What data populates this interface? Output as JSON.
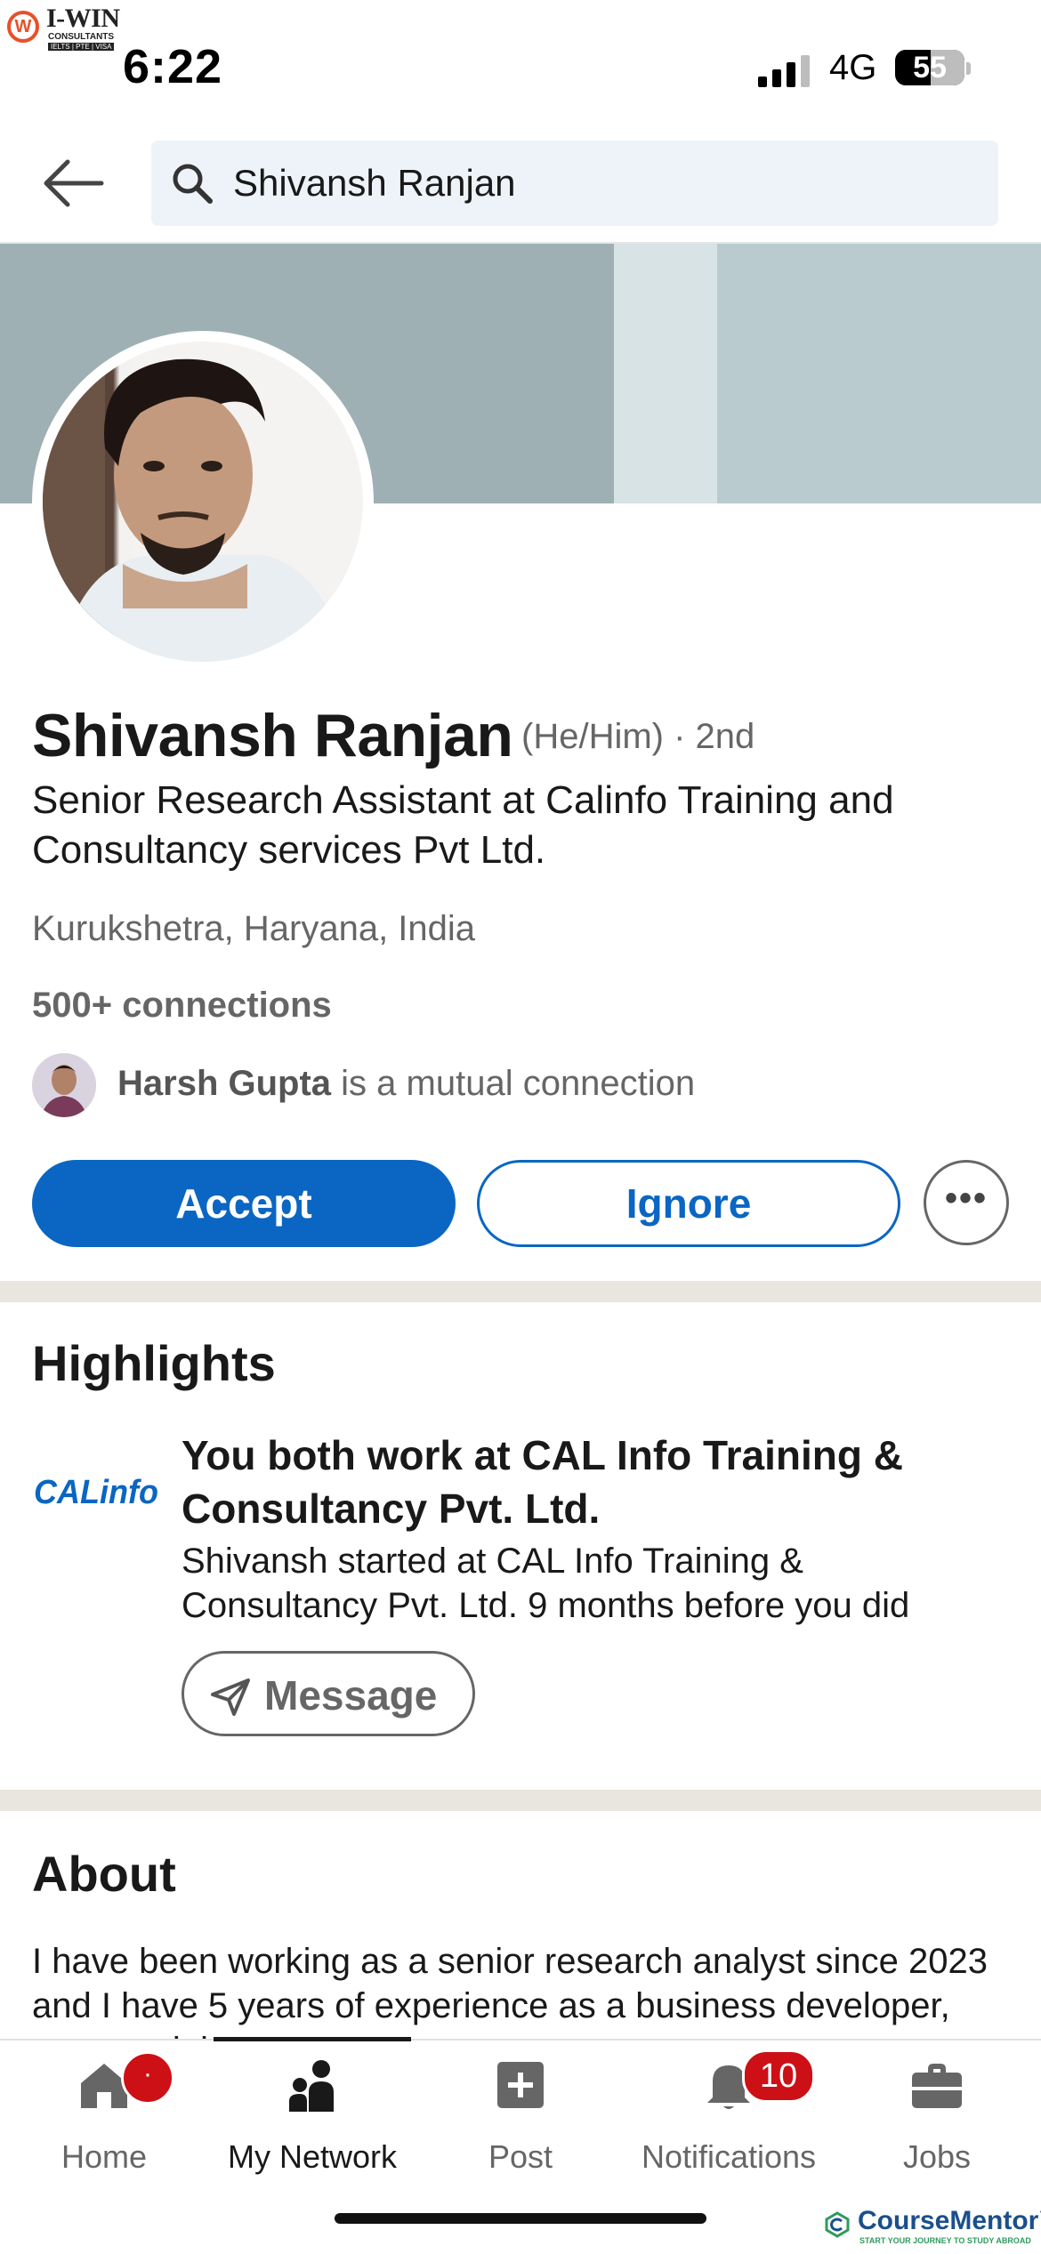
{
  "watermark_logo": {
    "title": "I-WIN",
    "subtitle": "CONSULTANTS",
    "tagline": "IELTS | PTE | VISA"
  },
  "status_bar": {
    "time": "6:22",
    "network": "4G",
    "battery": "55"
  },
  "search": {
    "query": "Shivansh Ranjan"
  },
  "profile": {
    "name": "Shivansh Ranjan",
    "pronouns_degree": "(He/Him) · 2nd",
    "headline": "Senior Research Assistant at Calinfo Training and Consultancy services Pvt Ltd.",
    "location": "Kurukshetra, Haryana, India",
    "connections": "500+ connections",
    "mutual_name": "Harsh Gupta",
    "mutual_suffix": " is a mutual connection"
  },
  "actions": {
    "accept": "Accept",
    "ignore": "Ignore",
    "more": "•••"
  },
  "highlights": {
    "title": "Highlights",
    "logo_text": "CALinfo",
    "item_title": "You both work at CAL Info Training & Consultancy Pvt. Ltd.",
    "item_desc": "Shivansh started at CAL Info Training & Consultancy Pvt. Ltd. 9 months before you did",
    "message_label": "Message"
  },
  "about": {
    "title": "About",
    "text": "I have been working as a senior research analyst since 2023 and I have 5 years of experience as a business developer, tutor, and th"
  },
  "nav": {
    "items": [
      {
        "label": "Home",
        "icon": "home-icon",
        "badge": "·"
      },
      {
        "label": "My Network",
        "icon": "network-icon",
        "active": true
      },
      {
        "label": "Post",
        "icon": "post-icon"
      },
      {
        "label": "Notifications",
        "icon": "bell-icon",
        "badge": "10"
      },
      {
        "label": "Jobs",
        "icon": "briefcase-icon"
      }
    ]
  },
  "footer_logo": {
    "title": "CourseMentor™",
    "subtitle": "START YOUR JOURNEY TO STUDY ABROAD"
  },
  "colors": {
    "primary": "#0a66c2",
    "badge": "#cc1016",
    "banner": "#b9cbcf"
  }
}
